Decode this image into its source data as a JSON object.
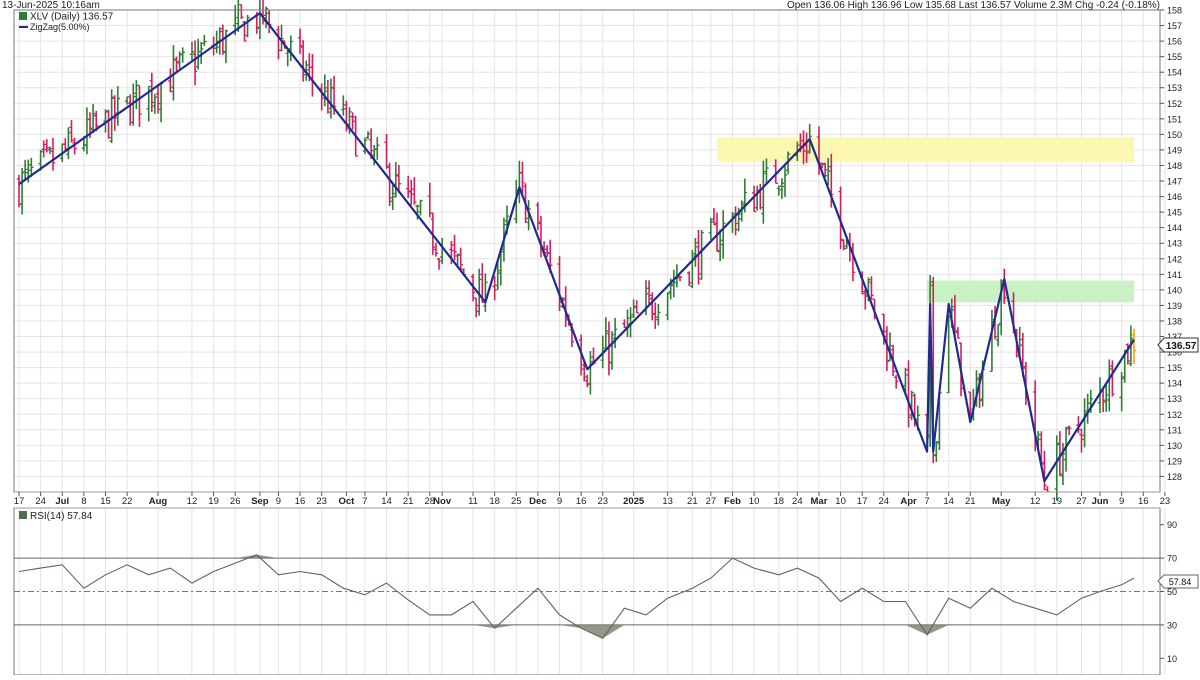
{
  "header": {
    "datetime": "13-Jun-2025 10:16am",
    "stats": "Open 136.06  High 136.96  Low 135.68  Last 136.57  Volume 2.3M  Chg -0.24 (-0.18%)"
  },
  "legend": {
    "symbol_line": "XLV (Daily) 136.57",
    "zigzag_line": "ZigZag(5.00%)"
  },
  "rsi_legend": "RSI(14) 57.84",
  "last_price_label": "136.57",
  "last_rsi_label": "57.84",
  "colors": {
    "up_bar": "#2e7d32",
    "down_bar": "#d81b60",
    "last_bar": "#f5a300",
    "zigzag": "#1f2b8f",
    "rsi_line": "#556b55",
    "rsi_fill": "#7b7b6b",
    "resistance_zone": "#fdf7b4",
    "support_zone": "#c9f2c3",
    "grid": "#e4e4e4",
    "axis": "#888888"
  },
  "chart_data": [
    {
      "type": "ohlc",
      "title": "XLV (Daily) 136.57",
      "series_name": "XLV (Daily)",
      "overlay_name": "ZigZag(5.00%)",
      "ylim": [
        127,
        158
      ],
      "y_ticks": [
        128,
        129,
        130,
        131,
        132,
        133,
        134,
        135,
        136,
        137,
        138,
        139,
        140,
        141,
        142,
        143,
        144,
        145,
        146,
        147,
        148,
        149,
        150,
        151,
        152,
        153,
        154,
        155,
        156,
        157,
        158
      ],
      "x_tick_labels": [
        "17",
        "24",
        "Jul",
        "8",
        "15",
        "22",
        "Aug",
        "12",
        "19",
        "26",
        "Sep",
        "9",
        "16",
        "23",
        "Oct",
        "7",
        "14",
        "21",
        "28",
        "Nov",
        "11",
        "18",
        "25",
        "Dec",
        "9",
        "16",
        "23",
        "2025",
        "13",
        "21",
        "27",
        "Feb",
        "10",
        "18",
        "24",
        "Mar",
        "10",
        "17",
        "24",
        "Apr",
        "7",
        "14",
        "21",
        "May",
        "12",
        "19",
        "27",
        "Jun",
        "9",
        "16",
        "23"
      ],
      "bold_x_labels": [
        "Jul",
        "Aug",
        "Sep",
        "Oct",
        "Nov",
        "Dec",
        "2025",
        "Feb",
        "Mar",
        "Apr",
        "May",
        "Jun"
      ],
      "zigzag_pivots": [
        {
          "date": "2024-06-17",
          "value": 146.8
        },
        {
          "date": "2024-09-03",
          "value": 157.8
        },
        {
          "date": "2024-11-15",
          "value": 139.2
        },
        {
          "date": "2024-11-26",
          "value": 146.6
        },
        {
          "date": "2024-12-18",
          "value": 134.9
        },
        {
          "date": "2025-02-28",
          "value": 149.7
        },
        {
          "date": "2025-04-07",
          "value": 129.6
        },
        {
          "date": "2025-04-08",
          "value": 139.1
        },
        {
          "date": "2025-04-09",
          "value": 129.6
        },
        {
          "date": "2025-04-14",
          "value": 139.1
        },
        {
          "date": "2025-04-21",
          "value": 131.5
        },
        {
          "date": "2025-05-02",
          "value": 140.7
        },
        {
          "date": "2025-05-15",
          "value": 127.7
        },
        {
          "date": "2025-06-13",
          "value": 136.8
        }
      ],
      "zones": [
        {
          "name": "resistance",
          "y_range": [
            148.2,
            149.8
          ],
          "x_range": [
            "2025-01-29",
            "2025-06-13"
          ]
        },
        {
          "name": "support",
          "y_range": [
            139.2,
            140.6
          ],
          "x_range": [
            "2025-04-07",
            "2025-06-13"
          ]
        }
      ],
      "last": {
        "open": 136.06,
        "high": 136.96,
        "low": 135.68,
        "close": 136.57,
        "volume": "2.3M",
        "change": -0.24,
        "change_pct": -0.18
      }
    },
    {
      "type": "line",
      "title": "RSI(14) 57.84",
      "ylim": [
        0,
        100
      ],
      "y_ticks": [
        10,
        30,
        50,
        70,
        90
      ],
      "reference_lines": [
        30,
        50,
        70
      ],
      "last_value": 57.84,
      "rsi_points": [
        [
          "2024-06-17",
          62
        ],
        [
          "2024-06-24",
          64
        ],
        [
          "2024-07-01",
          66
        ],
        [
          "2024-07-08",
          52
        ],
        [
          "2024-07-15",
          60
        ],
        [
          "2024-07-22",
          66
        ],
        [
          "2024-07-29",
          60
        ],
        [
          "2024-08-05",
          64
        ],
        [
          "2024-08-12",
          55
        ],
        [
          "2024-08-19",
          62
        ],
        [
          "2024-08-26",
          67
        ],
        [
          "2024-09-02",
          72
        ],
        [
          "2024-09-09",
          60
        ],
        [
          "2024-09-16",
          62
        ],
        [
          "2024-09-23",
          60
        ],
        [
          "2024-09-30",
          52
        ],
        [
          "2024-10-07",
          48
        ],
        [
          "2024-10-14",
          55
        ],
        [
          "2024-10-21",
          45
        ],
        [
          "2024-10-28",
          36
        ],
        [
          "2024-11-04",
          36
        ],
        [
          "2024-11-11",
          44
        ],
        [
          "2024-11-18",
          28
        ],
        [
          "2024-11-25",
          40
        ],
        [
          "2024-12-02",
          52
        ],
        [
          "2024-12-09",
          36
        ],
        [
          "2024-12-16",
          28
        ],
        [
          "2024-12-23",
          22
        ],
        [
          "2024-12-30",
          40
        ],
        [
          "2025-01-06",
          36
        ],
        [
          "2025-01-13",
          46
        ],
        [
          "2025-01-21",
          52
        ],
        [
          "2025-01-27",
          58
        ],
        [
          "2025-02-03",
          70
        ],
        [
          "2025-02-10",
          64
        ],
        [
          "2025-02-18",
          60
        ],
        [
          "2025-02-24",
          64
        ],
        [
          "2025-03-03",
          58
        ],
        [
          "2025-03-10",
          44
        ],
        [
          "2025-03-17",
          52
        ],
        [
          "2025-03-24",
          44
        ],
        [
          "2025-03-31",
          44
        ],
        [
          "2025-04-07",
          24
        ],
        [
          "2025-04-14",
          46
        ],
        [
          "2025-04-21",
          40
        ],
        [
          "2025-04-28",
          52
        ],
        [
          "2025-05-05",
          44
        ],
        [
          "2025-05-12",
          40
        ],
        [
          "2025-05-19",
          36
        ],
        [
          "2025-05-27",
          46
        ],
        [
          "2025-06-02",
          50
        ],
        [
          "2025-06-09",
          54
        ],
        [
          "2025-06-13",
          58
        ]
      ]
    }
  ]
}
